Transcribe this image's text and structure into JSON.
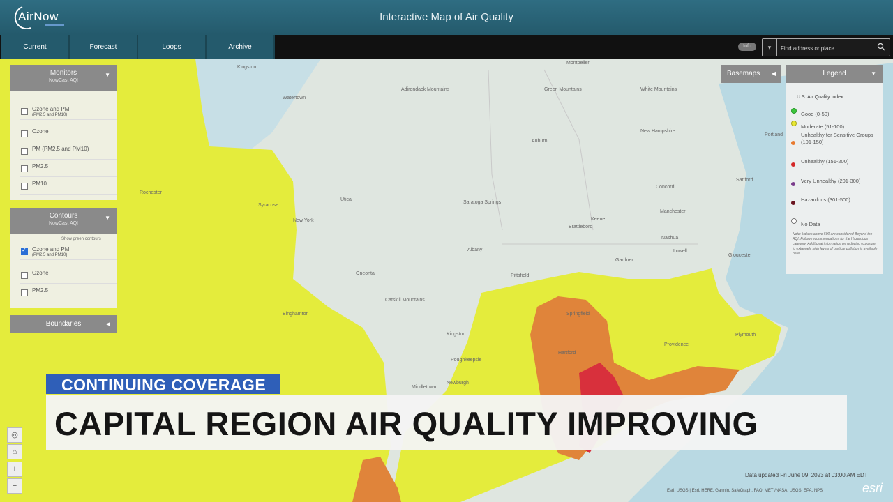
{
  "header": {
    "logo": "AirNow",
    "title": "Interactive Map of Air Quality"
  },
  "nav": {
    "tabs": [
      {
        "label": "Current"
      },
      {
        "label": "Forecast"
      },
      {
        "label": "Loops"
      },
      {
        "label": "Archive"
      }
    ]
  },
  "info_pill": "Info",
  "search": {
    "placeholder": "Find address or place"
  },
  "monitors": {
    "title": "Monitors",
    "subtitle": "NowCast AQI",
    "options": [
      {
        "label": "Ozone and PM",
        "sub": "(PM2.5 and PM10)",
        "checked": false
      },
      {
        "label": "Ozone",
        "sub": "",
        "checked": false
      },
      {
        "label": "PM (PM2.5 and PM10)",
        "sub": "",
        "checked": false
      },
      {
        "label": "PM2.5",
        "sub": "",
        "checked": false
      },
      {
        "label": "PM10",
        "sub": "",
        "checked": false
      }
    ]
  },
  "contours": {
    "title": "Contours",
    "subtitle": "NowCast AQI",
    "show_green": "Show green contours",
    "options": [
      {
        "label": "Ozone and PM",
        "sub": "(PM2.5 and PM10)",
        "checked": true
      },
      {
        "label": "Ozone",
        "sub": "",
        "checked": false
      },
      {
        "label": "PM2.5",
        "sub": "",
        "checked": false
      }
    ]
  },
  "boundaries": {
    "label": "Boundaries"
  },
  "basemaps": {
    "label": "Basemaps"
  },
  "legend": {
    "title": "Legend",
    "index_title": "U.S. Air Quality Index",
    "items": [
      {
        "label": "Good (0-50)",
        "color": "#3cc63c"
      },
      {
        "label": "Moderate (51-100)",
        "color": "#e8e832"
      },
      {
        "label": "Unhealthy for Sensitive Groups (101-150)",
        "color": "#e87a30"
      },
      {
        "label": "Unhealthy (151-200)",
        "color": "#d42828"
      },
      {
        "label": "Very Unhealthy (201-300)",
        "color": "#7a3c8c"
      },
      {
        "label": "Hazardous (301-500)",
        "color": "#6a1420"
      },
      {
        "label": "No Data",
        "color": "#ffffff"
      }
    ],
    "note": "Note: Values above 500 are considered Beyond the AQI. Follow recommendations for the Hazardous category. Additional information on reducing exposure to extremely high levels of particle pollution is available here."
  },
  "map": {
    "colors": {
      "land": "#dfe6e0",
      "water": "#b9d9e3",
      "moderate": "#e4ec3c",
      "usg": "#e0843a",
      "unhealthy": "#d8303c"
    },
    "labels": [
      {
        "text": "Kingston"
      },
      {
        "text": "Montpelier"
      },
      {
        "text": "Adirondack Mountains"
      },
      {
        "text": "Green Mountains"
      },
      {
        "text": "White Mountains"
      },
      {
        "text": "Watertown"
      },
      {
        "text": "Auburn"
      },
      {
        "text": "New Hampshire"
      },
      {
        "text": "Portland"
      },
      {
        "text": "Rochester"
      },
      {
        "text": "Syracuse"
      },
      {
        "text": "Utica"
      },
      {
        "text": "Saratoga Springs"
      },
      {
        "text": "Concord"
      },
      {
        "text": "Sanford"
      },
      {
        "text": "New York"
      },
      {
        "text": "Manchester"
      },
      {
        "text": "Keene"
      },
      {
        "text": "Brattleboro"
      },
      {
        "text": "Albany"
      },
      {
        "text": "Nashua"
      },
      {
        "text": "Lowell"
      },
      {
        "text": "Gardner"
      },
      {
        "text": "Gloucester"
      },
      {
        "text": "Oneonta"
      },
      {
        "text": "Pittsfield"
      },
      {
        "text": "Catskill Mountains"
      },
      {
        "text": "Springfield"
      },
      {
        "text": "Kingston"
      },
      {
        "text": "Hartford"
      },
      {
        "text": "Poughkeepsie"
      },
      {
        "text": "Plymouth"
      },
      {
        "text": "Providence"
      },
      {
        "text": "Middletown"
      },
      {
        "text": "Newburgh"
      },
      {
        "text": "Binghamton"
      }
    ]
  },
  "banner": {
    "tag": "CONTINUING COVERAGE",
    "headline": "CAPITAL REGION AIR QUALITY IMPROVING"
  },
  "map_controls": [
    {
      "glyph": "◎"
    },
    {
      "glyph": "⌂"
    },
    {
      "glyph": "+"
    },
    {
      "glyph": "−"
    }
  ],
  "footer": {
    "data_updated": "Data updated Fri June 09, 2023 at 03:00 AM EDT",
    "attribution": "Esri, USGS | Esri, HERE, Garmin, SafeGraph, FAO, METI/NASA, USGS, EPA, NPS",
    "esri_logo": "esri"
  }
}
